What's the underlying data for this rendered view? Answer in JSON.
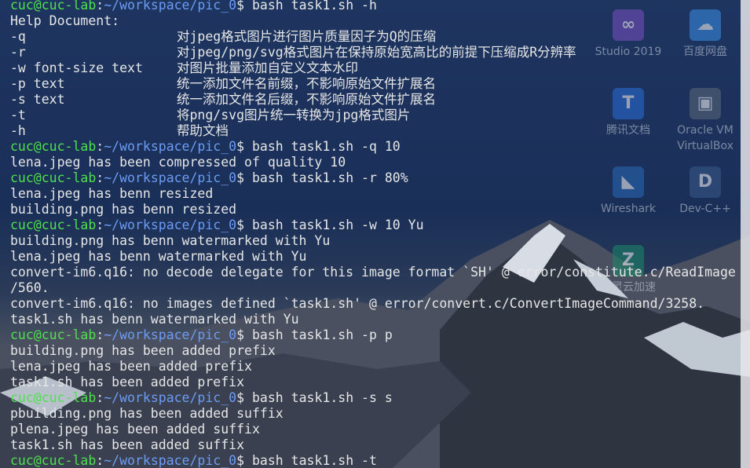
{
  "desktop": {
    "icons": [
      {
        "name": "visual-studio-icon",
        "label": "Studio 2019",
        "color": "#7a4fc0"
      },
      {
        "name": "baidu-netdisk-icon",
        "label": "百度网盘",
        "color": "#3a8ee6"
      },
      {
        "name": "tencent-docs-icon",
        "label": "腾讯文档",
        "color": "#2a6fd8"
      },
      {
        "name": "virtualbox-icon",
        "label": "Oracle VM VirtualBox",
        "color": "#5a6a7a"
      },
      {
        "name": "wireshark-icon",
        "label": "Wireshark",
        "color": "#2a6ab8"
      },
      {
        "name": "devcpp-icon",
        "label": "Dev-C++",
        "color": "#3a5a8a"
      },
      {
        "name": "zhiling-icon",
        "label": "智灵云加速",
        "color": "#1a8a6a"
      }
    ]
  },
  "terminal": {
    "prompt": {
      "user_host": "cuc@cuc-lab",
      "colon": ":",
      "path": "~/workspace/pic_0",
      "dollar": "$ "
    },
    "first_command": "bash task1.sh -h",
    "help_header": "Help Document:",
    "help": [
      {
        "opt": "-q",
        "desc": "对jpeg格式图片进行图片质量因子为Q的压缩"
      },
      {
        "opt": "-r",
        "desc": "对jpeg/png/svg格式图片在保持原始宽高比的前提下压缩成R分辨率"
      },
      {
        "opt": "-w font-size text",
        "desc": "对图片批量添加自定义文本水印"
      },
      {
        "opt": "-p text",
        "desc": "统一添加文件名前缀，不影响原始文件扩展名"
      },
      {
        "opt": "-s text",
        "desc": "统一添加文件名后缀，不影响原始文件扩展名"
      },
      {
        "opt": "-t",
        "desc": "将png/svg图片统一转换为jpg格式图片"
      },
      {
        "opt": "-h",
        "desc": "帮助文档"
      }
    ],
    "blocks": [
      {
        "command": "bash task1.sh -q 10",
        "output": [
          "lena.jpeg has been compressed of quality 10"
        ]
      },
      {
        "command": "bash task1.sh -r 80%",
        "output": [
          "lena.jpeg has benn resized",
          "building.png has benn resized"
        ]
      },
      {
        "command": "bash task1.sh -w 10 Yu",
        "output": [
          "building.png has benn watermarked with Yu",
          "lena.jpeg has benn watermarked with Yu",
          "convert-im6.q16: no decode delegate for this image format `SH' @ error/constitute.c/ReadImage",
          "/560.",
          "convert-im6.q16: no images defined `task1.sh' @ error/convert.c/ConvertImageCommand/3258.",
          "task1.sh has benn watermarked with Yu"
        ]
      },
      {
        "command": "bash task1.sh -p p",
        "output": [
          "building.png has been added prefix",
          "lena.jpeg has been added prefix",
          "task1.sh has been added prefix"
        ]
      },
      {
        "command": "bash task1.sh -s s",
        "output": [
          "pbuilding.png has been added suffix",
          "plena.jpeg has been added suffix",
          "task1.sh has been added suffix"
        ]
      },
      {
        "command": "bash task1.sh -t",
        "output": []
      }
    ]
  }
}
